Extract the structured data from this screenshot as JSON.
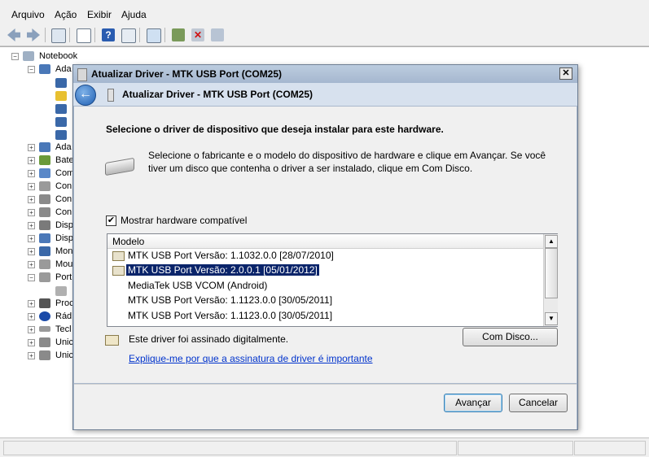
{
  "menu": [
    "Arquivo",
    "Ação",
    "Exibir",
    "Ajuda"
  ],
  "tree": {
    "root": "Notebook",
    "items": [
      "Ada",
      "Ada",
      "Bate",
      "Com",
      "Con",
      "Con",
      "Con",
      "Disp",
      "Disp",
      "Mon",
      "Mou",
      "Port",
      "Proc",
      "Rád",
      "Tecl",
      "Unic",
      "Unic"
    ]
  },
  "dialog": {
    "title": "Atualizar Driver - MTK USB Port (COM25)",
    "close": "✕",
    "header": "Atualizar Driver - MTK USB Port (COM25)",
    "instruction": "Selecione o driver de dispositivo que deseja instalar para este hardware.",
    "description": "Selecione o fabricante e o modelo do dispositivo de hardware e clique em Avançar. Se você tiver um disco que contenha o driver a ser instalado, clique em Com Disco.",
    "checkbox_label": "Mostrar hardware compatível",
    "checkbox_checked": true,
    "column_header": "Modelo",
    "models": [
      {
        "label": "MTK USB Port Versão: 1.1032.0.0 [28/07/2010]",
        "icon": true,
        "selected": false
      },
      {
        "label": "MTK USB Port Versão: 2.0.0.1 [05/01/2012]",
        "icon": true,
        "selected": true
      },
      {
        "label": "MediaTek USB VCOM (Android)",
        "icon": false,
        "selected": false
      },
      {
        "label": "MTK USB Port Versão: 1.1123.0.0 [30/05/2011]",
        "icon": false,
        "selected": false
      },
      {
        "label": "MTK USB Port Versão: 1.1123.0.0 [30/05/2011]",
        "icon": false,
        "selected": false
      }
    ],
    "signed_text": "Este driver foi assinado digitalmente.",
    "have_disk_button": "Com Disco...",
    "link": "Explique-me por que a assinatura de driver é importante",
    "next_button": "Avançar",
    "cancel_button": "Cancelar"
  }
}
